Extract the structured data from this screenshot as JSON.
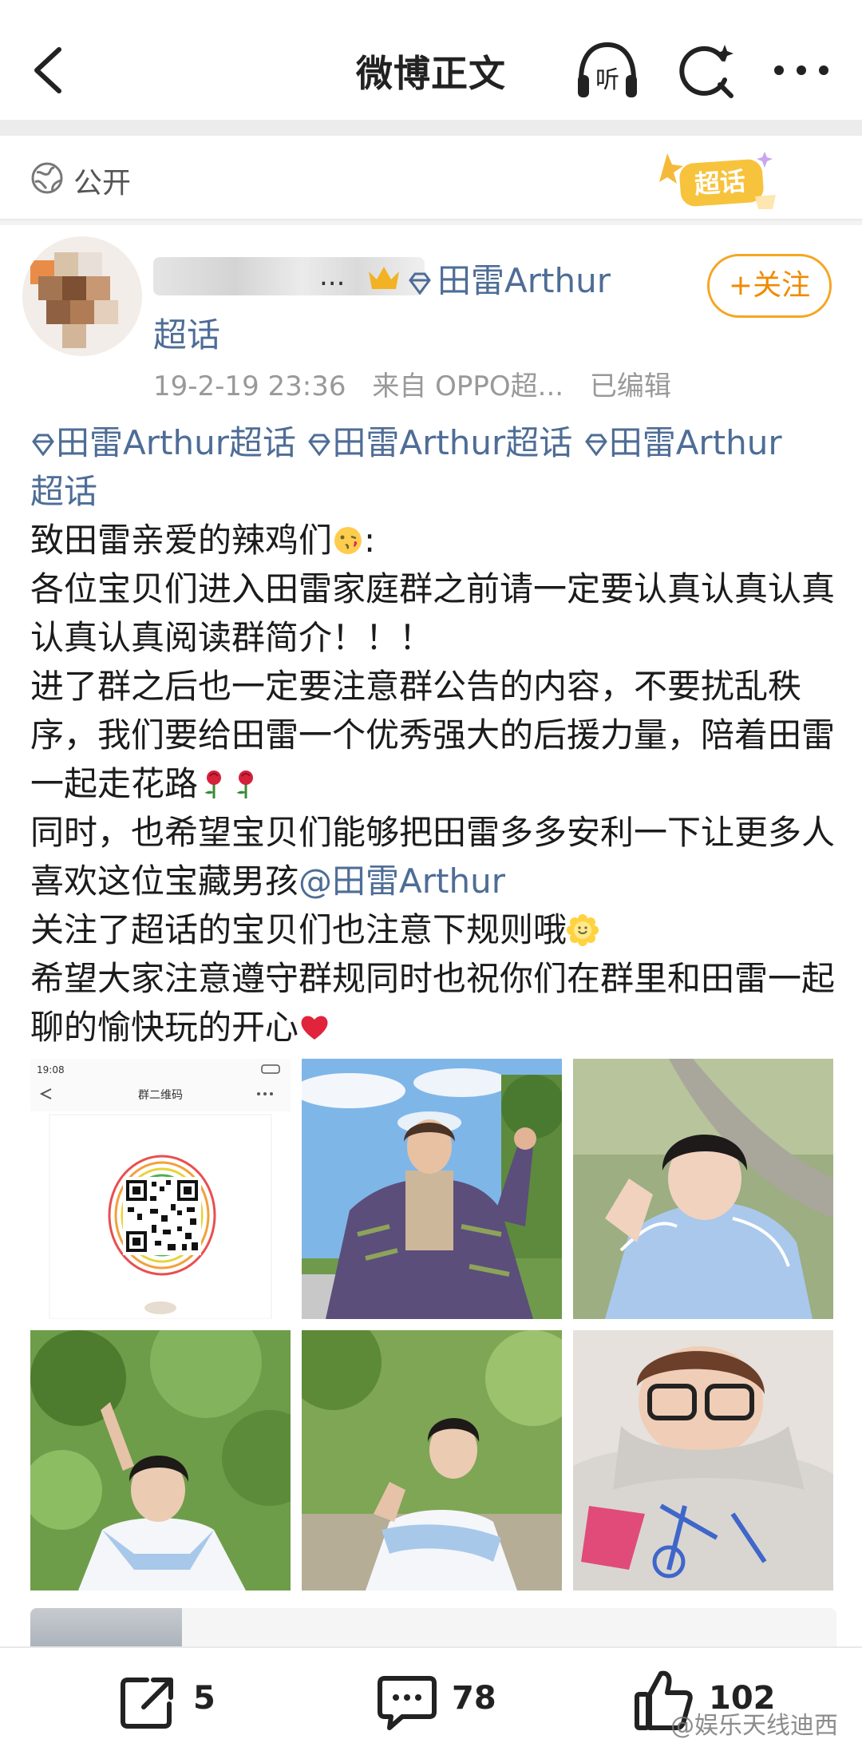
{
  "nav": {
    "title": "微博正文",
    "listen_label": "听"
  },
  "visibility": {
    "label": "公开",
    "sticker_label": "超话"
  },
  "author": {
    "topic_line1": "田雷Arthur",
    "topic_line2": "超话",
    "follow_label": "+关注",
    "ellipsis": "...",
    "time": "19-2-19 23:36",
    "source": "来自 OPPO超...",
    "edited": "已编辑"
  },
  "post": {
    "topics": [
      "田雷Arthur超话",
      "田雷Arthur超话",
      "田雷Arthur",
      "超话"
    ],
    "greeting": "致田雷亲爱的辣鸡们",
    "greeting_colon": ":",
    "para1": "各位宝贝们进入田雷家庭群之前请一定要认真认真认真认真认真阅读群简介！！！",
    "para2": "进了群之后也一定要注意群公告的内容，不要扰乱秩序，我们要给田雷一个优秀强大的后援力量，陪着田雷一起走花路",
    "para3_before": "同时，也希望宝贝们能够把田雷多多安利一下让更多人喜欢这位宝藏男孩",
    "mention": "@田雷Arthur",
    "para4": "关注了超话的宝贝们也注意下规则哦",
    "para5": "希望大家注意遵守群规同时也祝你们在群里和田雷一起聊的愉快玩的开心"
  },
  "images": {
    "qr_status_time": "19:08",
    "qr_page_title": "群二维码"
  },
  "actions": {
    "repost_count": "5",
    "comment_count": "78",
    "like_count": "102"
  },
  "watermark": "@娱乐天线迪西",
  "colors": {
    "link": "#4e6d96",
    "follow": "#f08a00",
    "meta": "#999999"
  }
}
